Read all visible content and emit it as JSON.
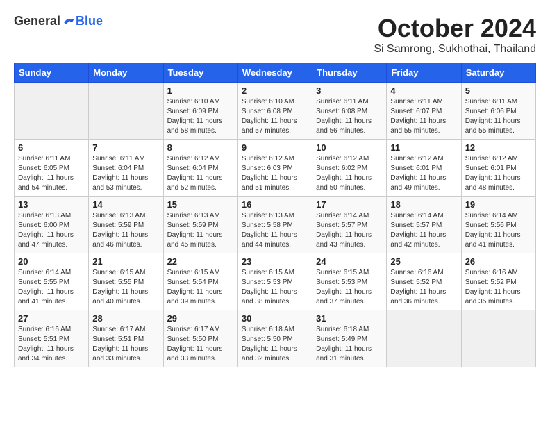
{
  "header": {
    "logo_general": "General",
    "logo_blue": "Blue",
    "month_title": "October 2024",
    "location": "Si Samrong, Sukhothai, Thailand"
  },
  "days_of_week": [
    "Sunday",
    "Monday",
    "Tuesday",
    "Wednesday",
    "Thursday",
    "Friday",
    "Saturday"
  ],
  "weeks": [
    [
      {
        "day": "",
        "info": ""
      },
      {
        "day": "",
        "info": ""
      },
      {
        "day": "1",
        "info": "Sunrise: 6:10 AM\nSunset: 6:09 PM\nDaylight: 11 hours and 58 minutes."
      },
      {
        "day": "2",
        "info": "Sunrise: 6:10 AM\nSunset: 6:08 PM\nDaylight: 11 hours and 57 minutes."
      },
      {
        "day": "3",
        "info": "Sunrise: 6:11 AM\nSunset: 6:08 PM\nDaylight: 11 hours and 56 minutes."
      },
      {
        "day": "4",
        "info": "Sunrise: 6:11 AM\nSunset: 6:07 PM\nDaylight: 11 hours and 55 minutes."
      },
      {
        "day": "5",
        "info": "Sunrise: 6:11 AM\nSunset: 6:06 PM\nDaylight: 11 hours and 55 minutes."
      }
    ],
    [
      {
        "day": "6",
        "info": "Sunrise: 6:11 AM\nSunset: 6:05 PM\nDaylight: 11 hours and 54 minutes."
      },
      {
        "day": "7",
        "info": "Sunrise: 6:11 AM\nSunset: 6:04 PM\nDaylight: 11 hours and 53 minutes."
      },
      {
        "day": "8",
        "info": "Sunrise: 6:12 AM\nSunset: 6:04 PM\nDaylight: 11 hours and 52 minutes."
      },
      {
        "day": "9",
        "info": "Sunrise: 6:12 AM\nSunset: 6:03 PM\nDaylight: 11 hours and 51 minutes."
      },
      {
        "day": "10",
        "info": "Sunrise: 6:12 AM\nSunset: 6:02 PM\nDaylight: 11 hours and 50 minutes."
      },
      {
        "day": "11",
        "info": "Sunrise: 6:12 AM\nSunset: 6:01 PM\nDaylight: 11 hours and 49 minutes."
      },
      {
        "day": "12",
        "info": "Sunrise: 6:12 AM\nSunset: 6:01 PM\nDaylight: 11 hours and 48 minutes."
      }
    ],
    [
      {
        "day": "13",
        "info": "Sunrise: 6:13 AM\nSunset: 6:00 PM\nDaylight: 11 hours and 47 minutes."
      },
      {
        "day": "14",
        "info": "Sunrise: 6:13 AM\nSunset: 5:59 PM\nDaylight: 11 hours and 46 minutes."
      },
      {
        "day": "15",
        "info": "Sunrise: 6:13 AM\nSunset: 5:59 PM\nDaylight: 11 hours and 45 minutes."
      },
      {
        "day": "16",
        "info": "Sunrise: 6:13 AM\nSunset: 5:58 PM\nDaylight: 11 hours and 44 minutes."
      },
      {
        "day": "17",
        "info": "Sunrise: 6:14 AM\nSunset: 5:57 PM\nDaylight: 11 hours and 43 minutes."
      },
      {
        "day": "18",
        "info": "Sunrise: 6:14 AM\nSunset: 5:57 PM\nDaylight: 11 hours and 42 minutes."
      },
      {
        "day": "19",
        "info": "Sunrise: 6:14 AM\nSunset: 5:56 PM\nDaylight: 11 hours and 41 minutes."
      }
    ],
    [
      {
        "day": "20",
        "info": "Sunrise: 6:14 AM\nSunset: 5:55 PM\nDaylight: 11 hours and 41 minutes."
      },
      {
        "day": "21",
        "info": "Sunrise: 6:15 AM\nSunset: 5:55 PM\nDaylight: 11 hours and 40 minutes."
      },
      {
        "day": "22",
        "info": "Sunrise: 6:15 AM\nSunset: 5:54 PM\nDaylight: 11 hours and 39 minutes."
      },
      {
        "day": "23",
        "info": "Sunrise: 6:15 AM\nSunset: 5:53 PM\nDaylight: 11 hours and 38 minutes."
      },
      {
        "day": "24",
        "info": "Sunrise: 6:15 AM\nSunset: 5:53 PM\nDaylight: 11 hours and 37 minutes."
      },
      {
        "day": "25",
        "info": "Sunrise: 6:16 AM\nSunset: 5:52 PM\nDaylight: 11 hours and 36 minutes."
      },
      {
        "day": "26",
        "info": "Sunrise: 6:16 AM\nSunset: 5:52 PM\nDaylight: 11 hours and 35 minutes."
      }
    ],
    [
      {
        "day": "27",
        "info": "Sunrise: 6:16 AM\nSunset: 5:51 PM\nDaylight: 11 hours and 34 minutes."
      },
      {
        "day": "28",
        "info": "Sunrise: 6:17 AM\nSunset: 5:51 PM\nDaylight: 11 hours and 33 minutes."
      },
      {
        "day": "29",
        "info": "Sunrise: 6:17 AM\nSunset: 5:50 PM\nDaylight: 11 hours and 33 minutes."
      },
      {
        "day": "30",
        "info": "Sunrise: 6:18 AM\nSunset: 5:50 PM\nDaylight: 11 hours and 32 minutes."
      },
      {
        "day": "31",
        "info": "Sunrise: 6:18 AM\nSunset: 5:49 PM\nDaylight: 11 hours and 31 minutes."
      },
      {
        "day": "",
        "info": ""
      },
      {
        "day": "",
        "info": ""
      }
    ]
  ]
}
